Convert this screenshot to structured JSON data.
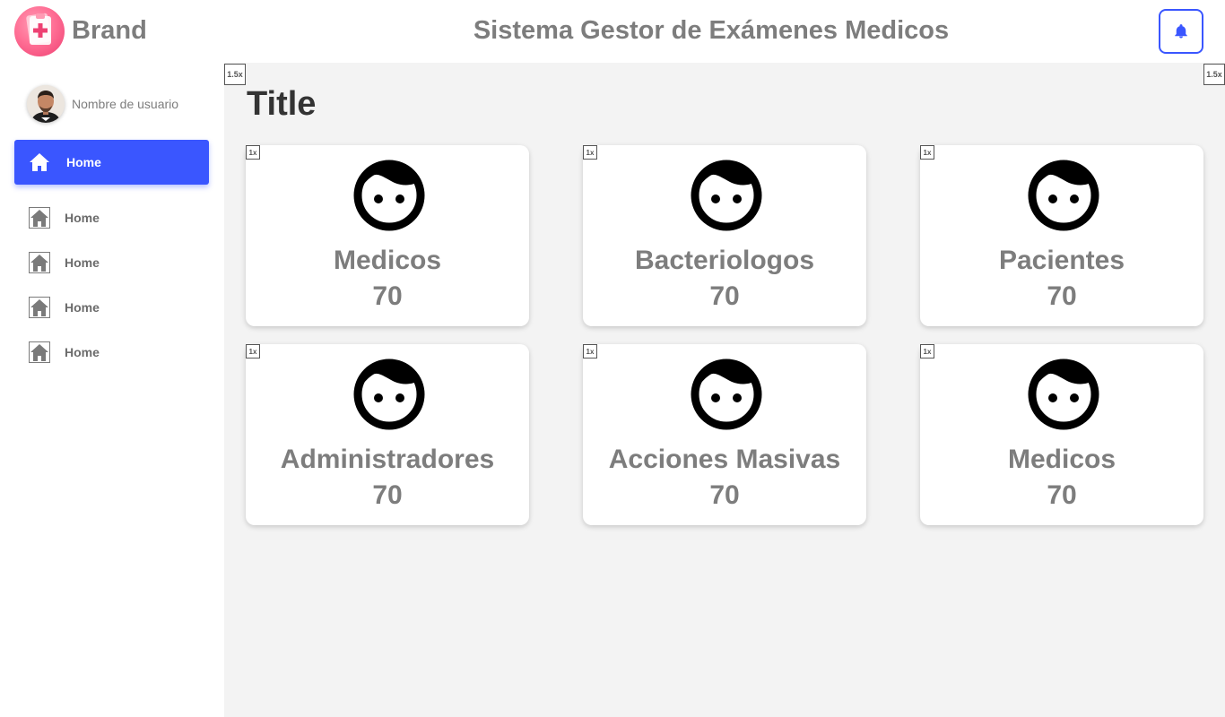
{
  "header": {
    "brand": "Brand",
    "title": "Sistema Gestor de Exámenes Medicos",
    "logo_icon": "medical-clipboard-icon",
    "notification_icon": "bell-icon",
    "accent_color": "#3a56ff"
  },
  "sidebar": {
    "user": {
      "name": "Nombre de usuario",
      "avatar": "user-avatar"
    },
    "active_item": {
      "label": "Home",
      "icon": "home-icon"
    },
    "items": [
      {
        "label": "Home",
        "icon": "home-icon"
      },
      {
        "label": "Home",
        "icon": "home-icon"
      },
      {
        "label": "Home",
        "icon": "home-icon"
      },
      {
        "label": "Home",
        "icon": "home-icon"
      }
    ]
  },
  "main": {
    "title": "Title",
    "zoom_tags": {
      "left": "1.5x",
      "right": "1.5x"
    },
    "cards": [
      {
        "tag": "1x",
        "icon": "face-icon",
        "name": "Medicos",
        "count": "70"
      },
      {
        "tag": "1x",
        "icon": "face-icon",
        "name": "Bacteriologos",
        "count": "70"
      },
      {
        "tag": "1x",
        "icon": "face-icon",
        "name": "Pacientes",
        "count": "70"
      },
      {
        "tag": "1x",
        "icon": "face-icon",
        "name": "Administradores",
        "count": "70"
      },
      {
        "tag": "1x",
        "icon": "face-icon",
        "name": "Acciones Masivas",
        "count": "70"
      },
      {
        "tag": "1x",
        "icon": "face-icon",
        "name": "Medicos",
        "count": "70"
      }
    ]
  }
}
